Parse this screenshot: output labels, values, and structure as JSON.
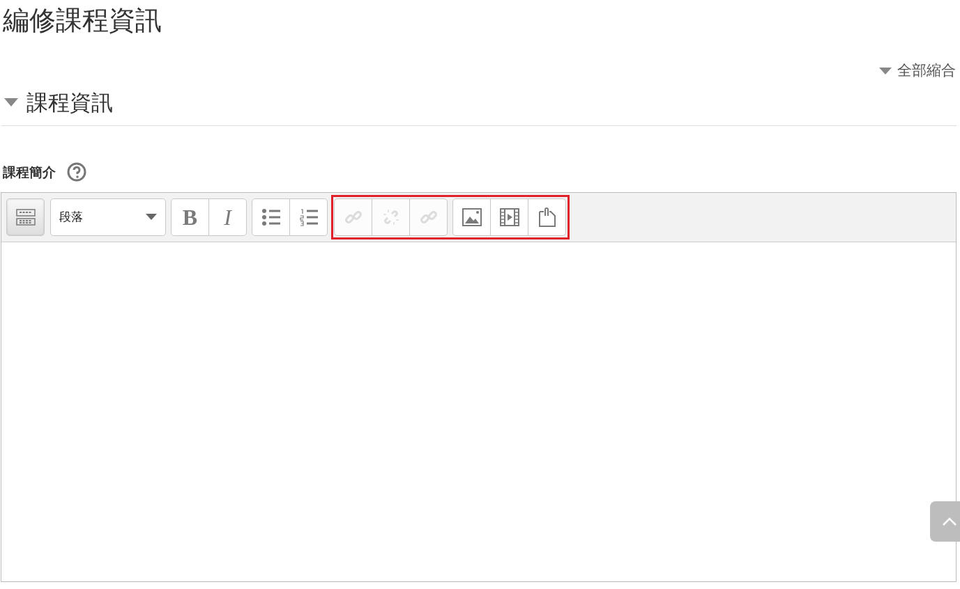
{
  "page_title": "編修課程資訊",
  "collapse_all": {
    "label": "全部縮合"
  },
  "section": {
    "title": "課程資訊",
    "expanded": true
  },
  "field": {
    "label": "課程簡介"
  },
  "toolbar": {
    "groups": [
      {
        "buttons": [
          {
            "kind": "toggle",
            "pressed": true,
            "disabled": false
          }
        ]
      },
      {
        "buttons": [
          {
            "kind": "select",
            "value": "段落",
            "disabled": false
          }
        ]
      },
      {
        "buttons": [
          {
            "kind": "text",
            "label": "B",
            "disabled": false
          },
          {
            "kind": "text",
            "label": "I",
            "disabled": false
          }
        ]
      },
      {
        "buttons": [
          {
            "kind": "bullets",
            "disabled": false
          },
          {
            "kind": "numbers",
            "disabled": false
          }
        ]
      }
    ],
    "highlight": {
      "groups": [
        {
          "buttons": [
            {
              "kind": "link",
              "disabled": true
            },
            {
              "kind": "unlink",
              "disabled": true
            },
            {
              "kind": "link",
              "disabled": true
            }
          ]
        },
        {
          "buttons": [
            {
              "kind": "image",
              "disabled": false
            },
            {
              "kind": "video",
              "disabled": false
            },
            {
              "kind": "clipboard",
              "disabled": false
            }
          ]
        }
      ]
    }
  }
}
